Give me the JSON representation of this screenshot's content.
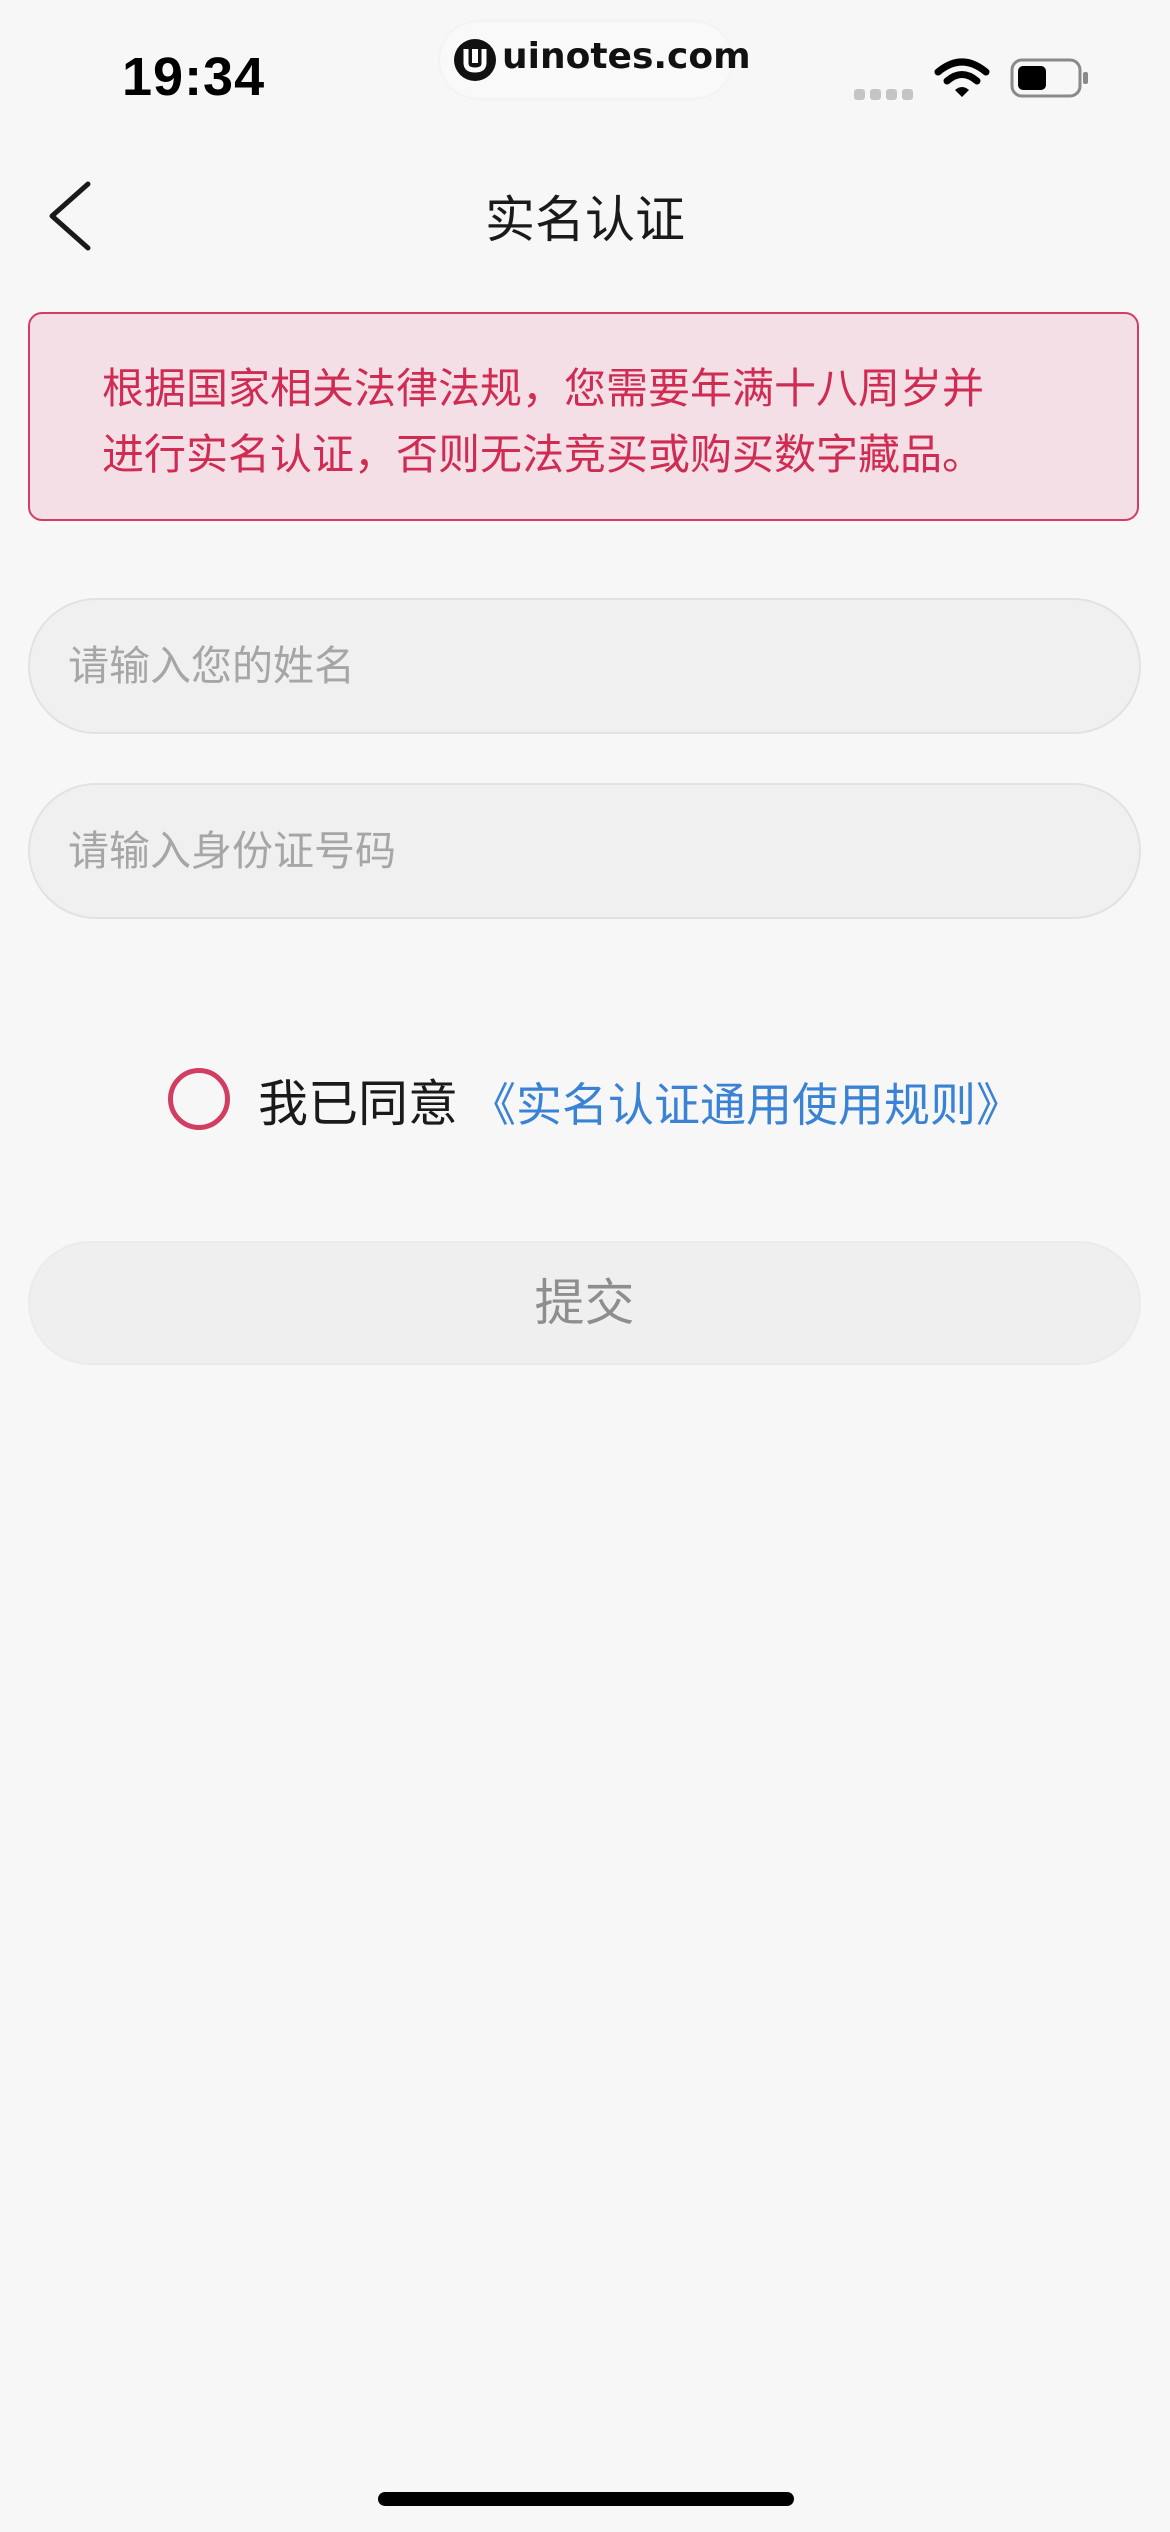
{
  "status_bar": {
    "time": "19:34",
    "watermark": "uinotes.com",
    "icons": [
      "signal-icon",
      "wifi-icon",
      "battery-icon"
    ]
  },
  "nav": {
    "back_icon": "chevron-left-icon",
    "title": "实名认证"
  },
  "notice": {
    "line1": "根据国家相关法律法规，您需要年满十八周岁并",
    "line2": "进行实名认证，否则无法竞买或购买数字藏品。"
  },
  "form": {
    "name_placeholder": "请输入您的姓名",
    "name_value": "",
    "id_placeholder": "请输入身份证号码",
    "id_value": ""
  },
  "agreement": {
    "checked": false,
    "text": "我已同意",
    "link": "《实名认证通用使用规则》"
  },
  "submit": {
    "label": "提交"
  },
  "colors": {
    "accent": "#d23d62",
    "notice_bg": "#f3dfe5",
    "link": "#3a83d4",
    "background": "#f7f7f7"
  }
}
